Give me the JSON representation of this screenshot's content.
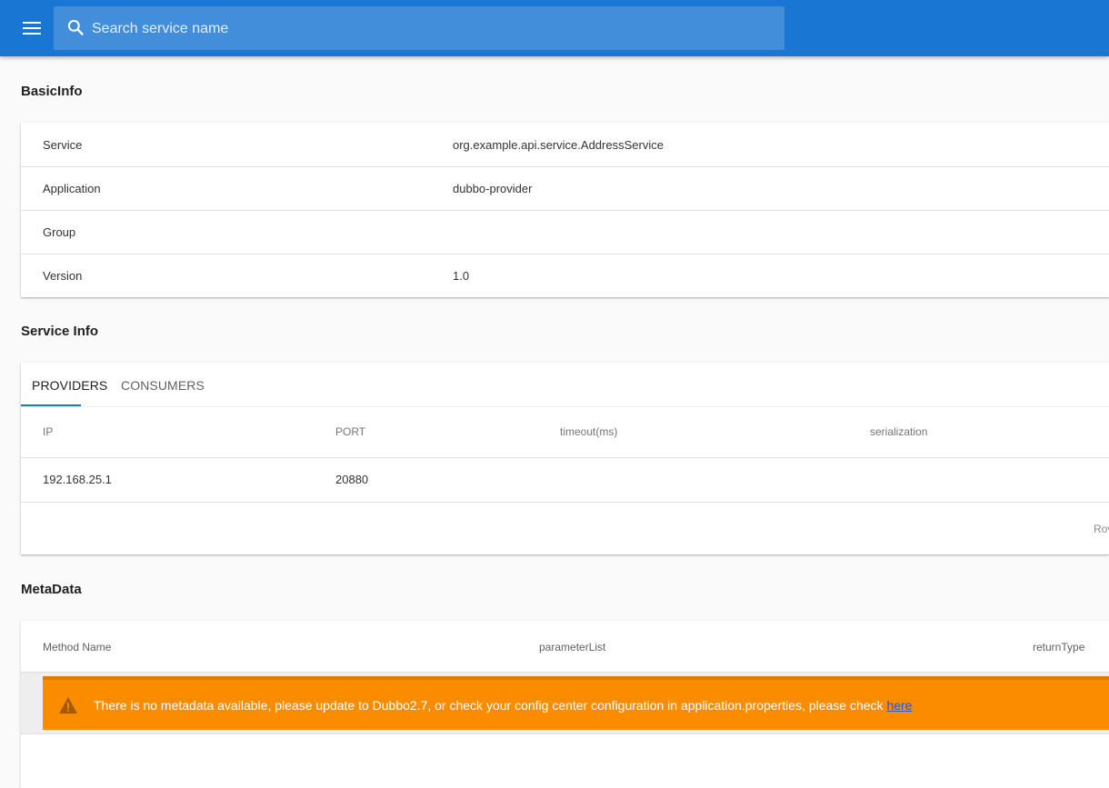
{
  "search": {
    "placeholder": "Search service name"
  },
  "basic_info": {
    "title": "BasicInfo",
    "rows": [
      {
        "key": "Service",
        "value": "org.example.api.service.AddressService"
      },
      {
        "key": "Application",
        "value": "dubbo-provider"
      },
      {
        "key": "Group",
        "value": ""
      },
      {
        "key": "Version",
        "value": "1.0"
      }
    ]
  },
  "service_info": {
    "title": "Service Info",
    "tabs": [
      "PROVIDERS",
      "CONSUMERS"
    ],
    "columns": [
      "IP",
      "PORT",
      "timeout(ms)",
      "serialization"
    ],
    "rows": [
      {
        "ip": "192.168.25.1",
        "port": "20880",
        "timeout": "",
        "serialization": ""
      }
    ],
    "footer_label": "Rov"
  },
  "metadata": {
    "title": "MetaData",
    "columns": [
      "Method Name",
      "parameterList",
      "returnType"
    ],
    "alert_text": "There is no metadata available, please update to Dubbo2.7, or check your config center configuration in application.properties, please check ",
    "alert_link": "here"
  },
  "colors": {
    "appbar": "#1976d2",
    "alert": "#fb8c00"
  }
}
